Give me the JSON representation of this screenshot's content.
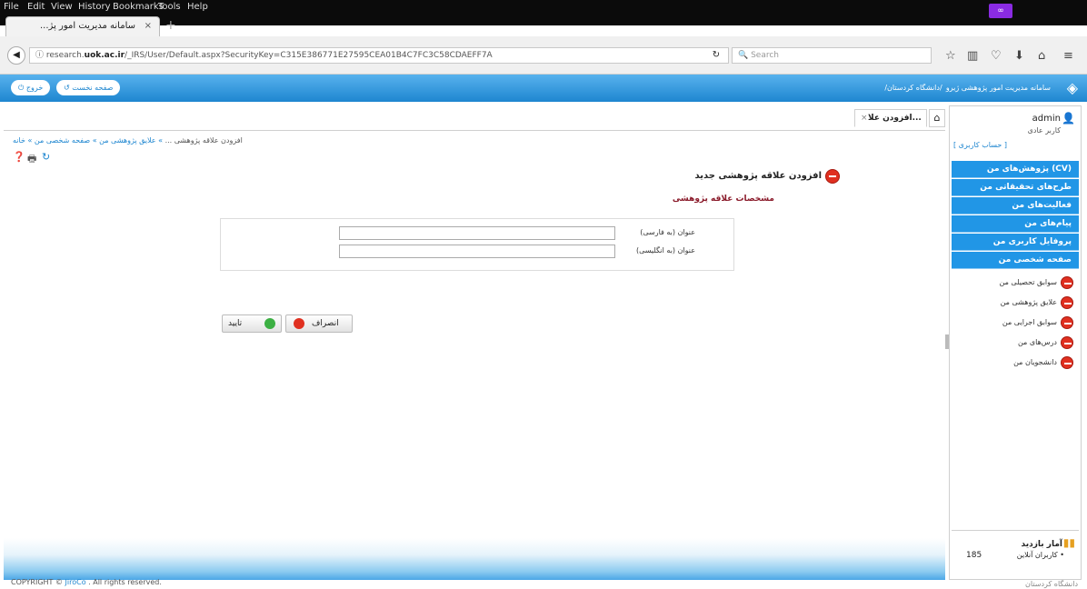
{
  "browser": {
    "menu": [
      "File",
      "Edit",
      "View",
      "History",
      "Bookmarks",
      "Tools",
      "Help"
    ],
    "tab_title": "...سامانه مدیریت امور پژ",
    "tab_close": "×",
    "new_tab": "+",
    "url_prefix": "research.",
    "url_domain": "uok.ac.ir",
    "url_path": "/_IRS/User/Default.aspx?SecurityKey=C315E386771E27595CEA01B4C7FC3C58CDAEFF7A",
    "search_placeholder": "Search",
    "profile_badge": "∞"
  },
  "app": {
    "title": "سامانه مدیریت امور پژوهشی ژیرو",
    "subtitle": "/دانشگاه کردستان/",
    "btn_exit": "خروج",
    "btn_home": "صفحه نخست"
  },
  "sidebar": {
    "username": "admin",
    "role": "کاربر عادی",
    "account_link": "[ حساب کاربری ]",
    "menu": [
      "پژوهش‌های من (CV)",
      "طرح‌های تحقیقاتی من",
      "فعالیت‌های من",
      "پیام‌های من",
      "پروفایل کاربری من",
      "صفحه شخصی من"
    ],
    "submenu": [
      "سوابق تحصیلی من",
      "علایق پژوهشی من",
      "سوابق اجرایی من",
      "درس‌های من",
      "دانشجویان من"
    ],
    "stats_title": "آمار بازدید",
    "online_label": "کاربران آنلاین",
    "online_count": "185"
  },
  "content": {
    "tab_label": "افزودن علا...",
    "breadcrumb": [
      "خانه",
      "صفحه شخصی من",
      "علایق پژوهشی من"
    ],
    "breadcrumb_current": "افزودن علاقه پژوهشی ...",
    "breadcrumb_sep": "»",
    "form_title": "افزودن علاقه پژوهشی جدید",
    "section_title": "مشخصات علاقه پژوهشی",
    "field_fa_label": "عنوان (به فارسی)",
    "field_en_label": "عنوان (به انگلیسی)",
    "field_fa_value": "",
    "field_en_value": "",
    "btn_cancel": "انصراف",
    "btn_confirm": "تایید"
  },
  "footer": {
    "copyright": "COPYRIGHT © ",
    "brand": "JiroCo",
    "rights": " . All rights reserved.",
    "university": "دانشگاه کردستان"
  },
  "colors": {
    "accent": "#2196e6",
    "header": "#1e86d0",
    "danger": "#e03020",
    "success": "#3cb043"
  }
}
